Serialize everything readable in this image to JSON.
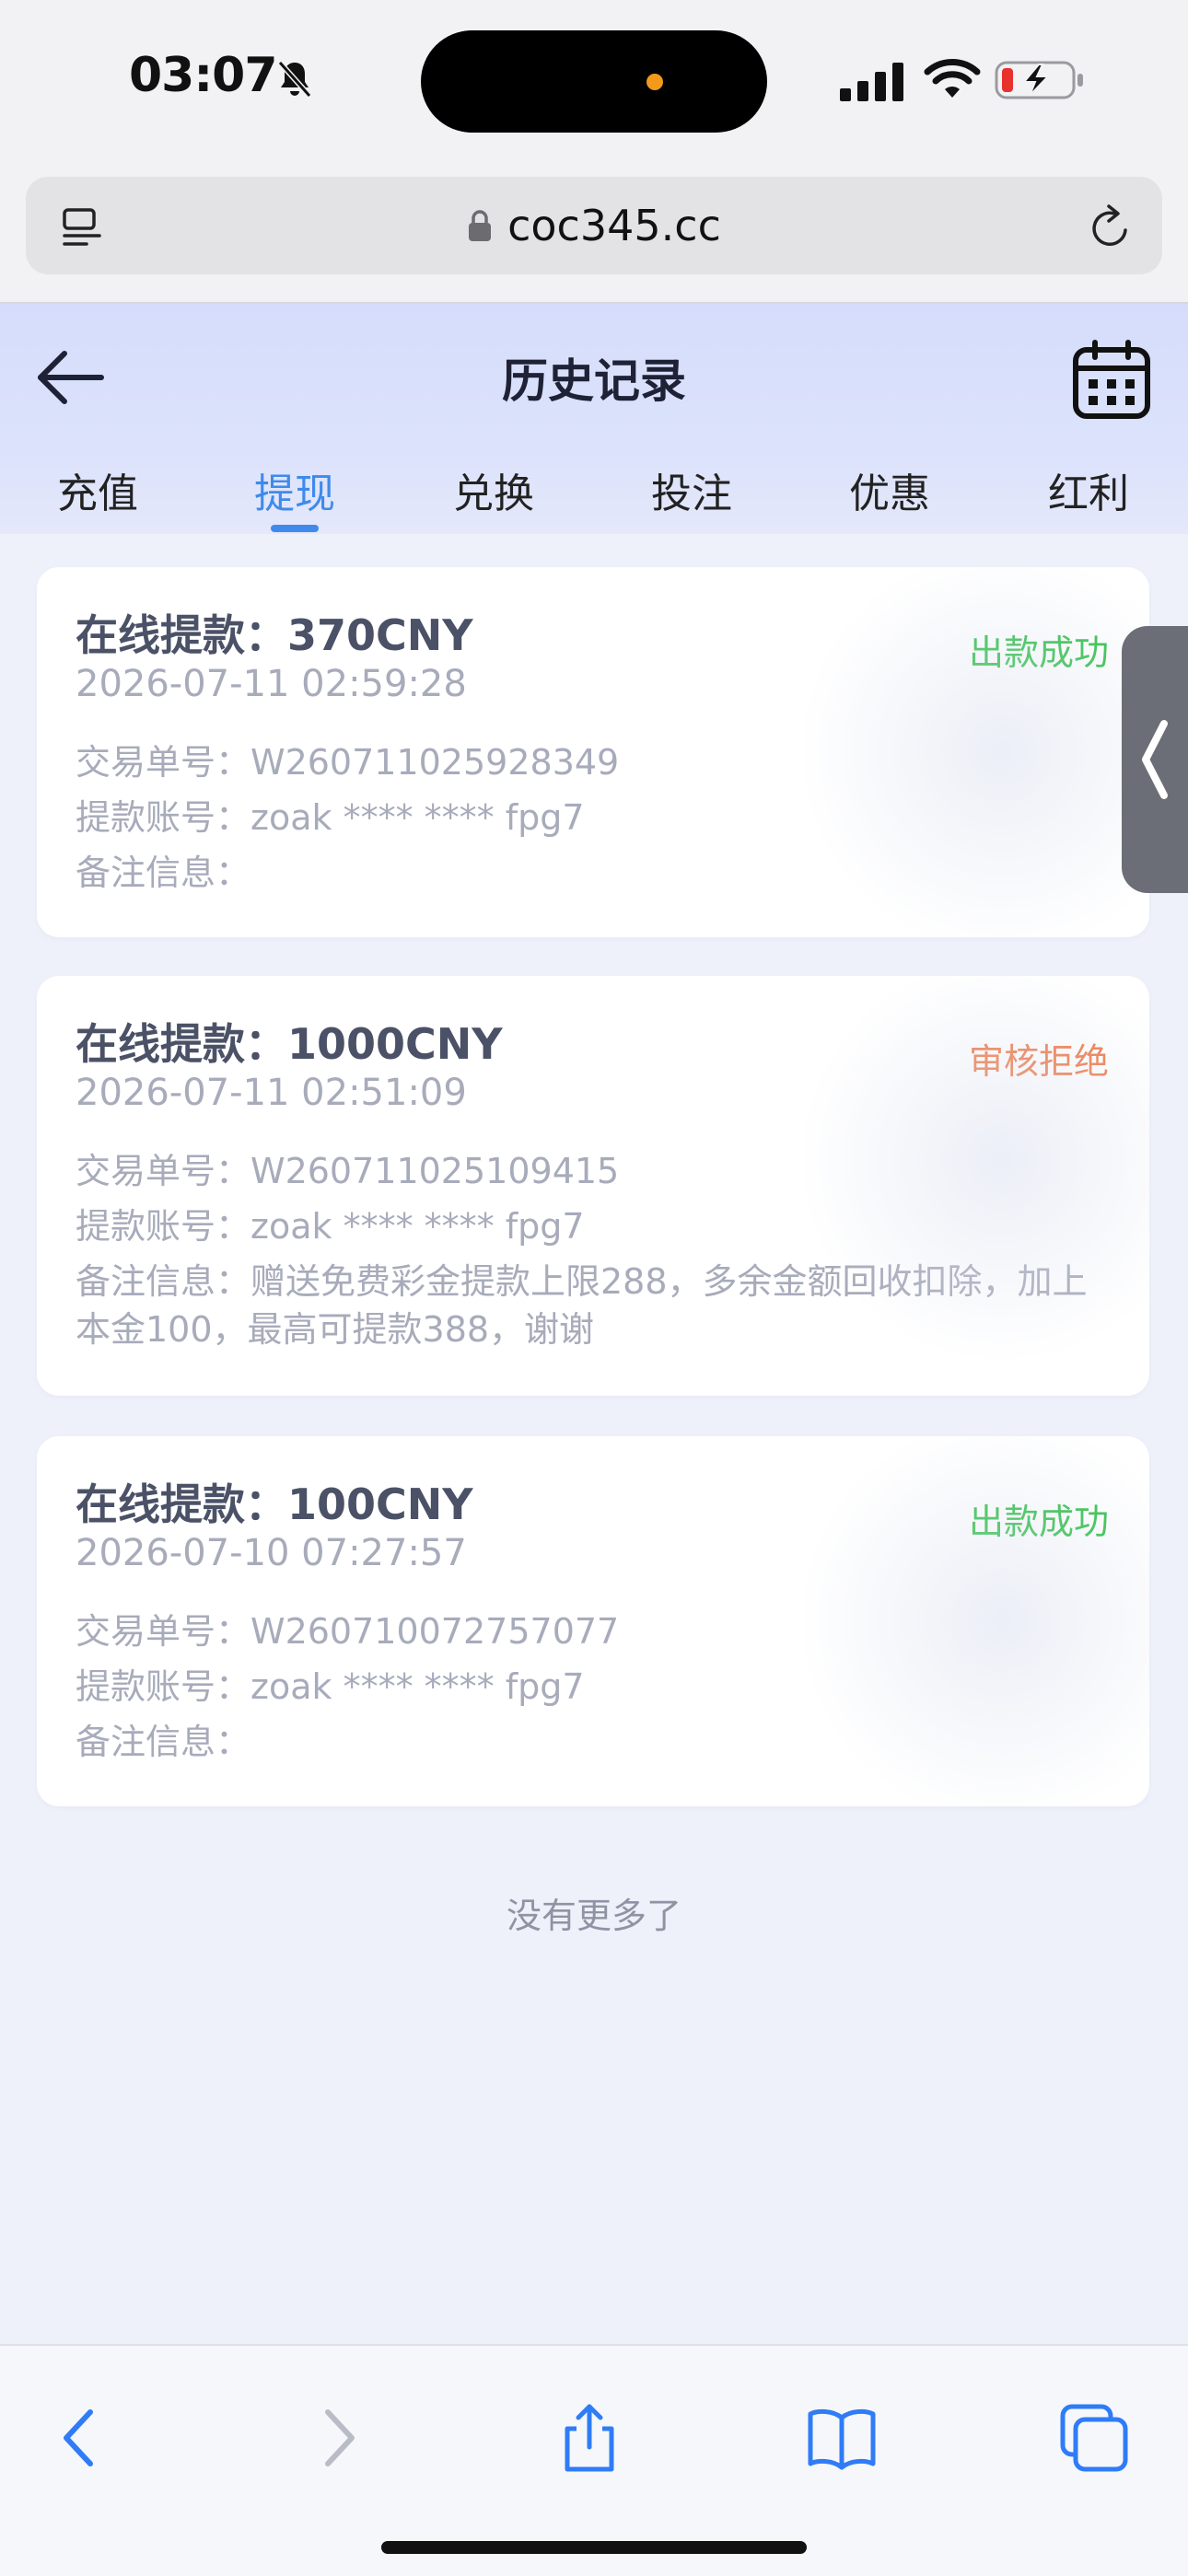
{
  "status_bar": {
    "time": "03:07",
    "icons": [
      "bell-muted-icon",
      "signal-icon",
      "wifi-icon",
      "battery-charging-icon"
    ]
  },
  "browser": {
    "url": "coc345.cc",
    "left_icon": "reader-icon",
    "right_icon": "reload-icon"
  },
  "header": {
    "title": "历史记录",
    "back_icon": "back-arrow-icon",
    "calendar_icon": "calendar-icon"
  },
  "tabs": [
    {
      "label": "充值",
      "active": false
    },
    {
      "label": "提现",
      "active": true
    },
    {
      "label": "兑换",
      "active": false
    },
    {
      "label": "投注",
      "active": false
    },
    {
      "label": "优惠",
      "active": false
    },
    {
      "label": "红利",
      "active": false
    }
  ],
  "records": [
    {
      "title": "在线提款：370CNY",
      "time": "2026-07-11 02:59:28",
      "status": "出款成功",
      "order": "交易单号：W260711025928349",
      "account": "提款账号：zoak **** **** fpg7",
      "remark": "备注信息："
    },
    {
      "title": "在线提款：1000CNY",
      "time": "2026-07-11 02:51:09",
      "status": "审核拒绝",
      "order": "交易单号：W260711025109415",
      "account": "提款账号：zoak **** **** fpg7",
      "remark": "备注信息：赠送免费彩金提款上限288，多余金额回收扣除，加上本金100，最高可提款388，谢谢"
    },
    {
      "title": "在线提款：100CNY",
      "time": "2026-07-10 07:27:57",
      "status": "出款成功",
      "order": "交易单号：W260710072757077",
      "account": "提款账号：zoak **** **** fpg7",
      "remark": "备注信息："
    }
  ],
  "list_end": "没有更多了",
  "colors": {
    "accent": "#3f8aec",
    "success": "#2bbf44",
    "rejected": "#ef7a48"
  },
  "toolbar_icons": [
    "browser-back-icon",
    "browser-forward-icon",
    "share-icon",
    "bookmarks-icon",
    "tabs-icon"
  ]
}
